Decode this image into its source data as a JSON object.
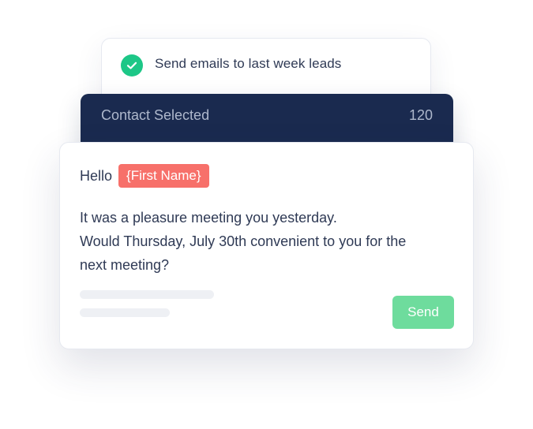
{
  "task": {
    "title": "Send emails to last week leads",
    "status_icon": "check-circle-icon",
    "status_color": "#1dc787"
  },
  "contacts": {
    "label": "Contact Selected",
    "count": "120",
    "background": "#1a2a4f"
  },
  "message": {
    "greeting": "Hello",
    "name_placeholder": "{First Name}",
    "tag_color": "#f7706a",
    "lines": [
      "It was a pleasure meeting you yesterday.",
      "Would Thursday, July 30th convenient to you for the",
      "next meeting?"
    ],
    "send_label": "Send",
    "send_color": "#6edc9d"
  }
}
